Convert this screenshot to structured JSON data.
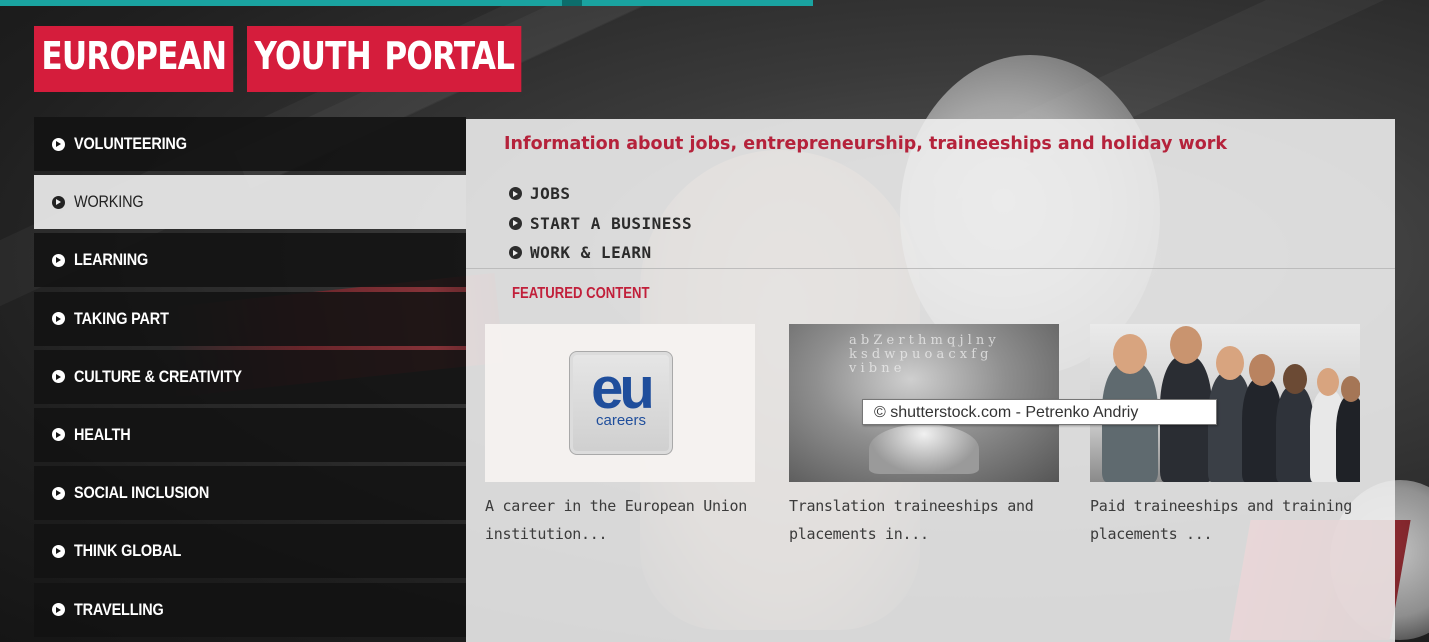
{
  "logo": {
    "words": [
      "EUROPEAN",
      "YOUTH",
      "PORTAL"
    ]
  },
  "menu": {
    "items": [
      {
        "label": "VOLUNTEERING"
      },
      {
        "label": "WORKING"
      },
      {
        "label": "LEARNING"
      },
      {
        "label": "TAKING PART"
      },
      {
        "label": "CULTURE & CREATIVITY"
      },
      {
        "label": "HEALTH"
      },
      {
        "label": "SOCIAL INCLUSION"
      },
      {
        "label": "THINK GLOBAL"
      },
      {
        "label": "TRAVELLING"
      }
    ],
    "active": "WORKING"
  },
  "panel": {
    "heading": "Information about jobs, entrepreneurship, traineeships and holiday work",
    "links": [
      {
        "label": "JOBS"
      },
      {
        "label": "START A BUSINESS"
      },
      {
        "label": "WORK & LEARN"
      }
    ],
    "featured_heading": "FEATURED CONTENT",
    "cards": [
      {
        "description": "A career in the European Union institution...",
        "logo_text": "eu",
        "logo_subtext": "careers"
      },
      {
        "description": "Translation traineeships and placements in..."
      },
      {
        "description": "Paid traineeships and training placements ..."
      }
    ]
  },
  "tooltip": {
    "text": "© shutterstock.com - Petrenko Andriy"
  },
  "colors": {
    "brand_red": "#d51d3c",
    "heading_red": "#b5223b",
    "menu_bg": "#121212",
    "panel_bg": "#f0f0f0",
    "top_bar": "#1aa3a0",
    "eu_blue": "#1f4e9c"
  }
}
